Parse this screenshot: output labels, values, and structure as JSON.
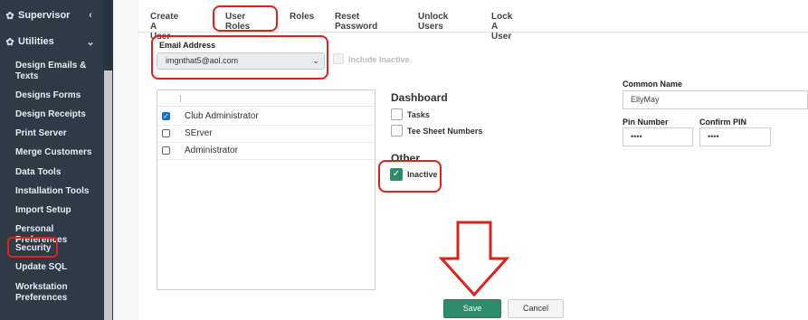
{
  "sidebar": {
    "sections": [
      {
        "label": "Supervisor",
        "chevron": "‹"
      },
      {
        "label": "Utilities",
        "chevron": "⌄"
      }
    ],
    "items": [
      {
        "label": "Design Emails & Texts"
      },
      {
        "label": "Designs Forms"
      },
      {
        "label": "Design Receipts"
      },
      {
        "label": "Print Server"
      },
      {
        "label": "Merge Customers"
      },
      {
        "label": "Data Tools"
      },
      {
        "label": "Installation Tools"
      },
      {
        "label": "Import Setup"
      },
      {
        "label": "Personal Preferences"
      },
      {
        "label": "Security"
      },
      {
        "label": "Update SQL"
      },
      {
        "label": "Workstation Preferences"
      }
    ]
  },
  "tabs": [
    {
      "label": "Create A User"
    },
    {
      "label": "User Roles"
    },
    {
      "label": "Roles"
    },
    {
      "label": "Reset Password"
    },
    {
      "label": "Unlock Users"
    },
    {
      "label": "Lock A User"
    }
  ],
  "email": {
    "label": "Email Address",
    "value": "imgnthat5@aol.com",
    "include_inactive_label": "Include Inactive"
  },
  "roles": [
    {
      "label": "Club Administrator",
      "checked": true
    },
    {
      "label": "SErver",
      "checked": false
    },
    {
      "label": "Administrator",
      "checked": false
    }
  ],
  "permissions": {
    "dashboard_title": "Dashboard",
    "dashboard_items": [
      {
        "label": "Tasks"
      },
      {
        "label": "Tee Sheet Numbers"
      }
    ],
    "other_title": "Other",
    "other_items": [
      {
        "label": "Inactive",
        "checked": true
      }
    ]
  },
  "fields": {
    "common_name_label": "Common Name",
    "common_name_value": "EllyMay",
    "pin_label": "Pin Number",
    "pin_value": "••••",
    "confirm_pin_label": "Confirm PIN",
    "confirm_pin_value": "••••"
  },
  "buttons": {
    "save": "Save",
    "cancel": "Cancel"
  },
  "colors": {
    "sidebar_bg": "#2f3a45",
    "accent_green": "#2e8b6b",
    "annotation_red": "#e0201a"
  },
  "icons": {
    "section": "gear-icon",
    "arrow": "down-arrow-annotation-icon"
  }
}
